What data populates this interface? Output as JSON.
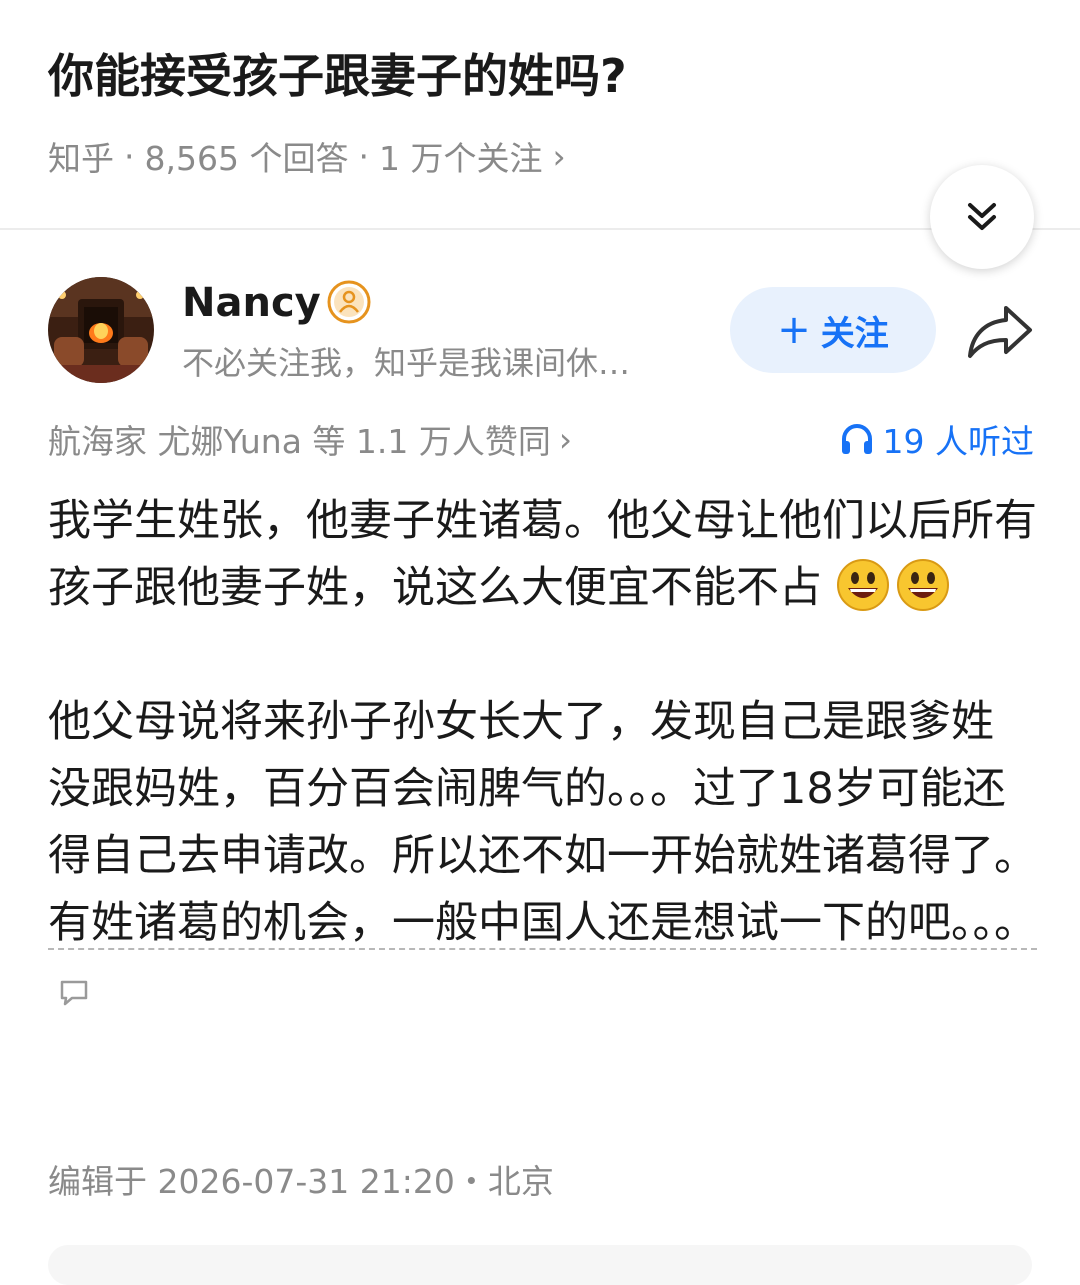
{
  "question": {
    "title": "你能接受孩子跟妻子的姓吗?",
    "source": "知乎",
    "answers": "8,565 个回答",
    "followers": "1 万个关注",
    "chevron": "›"
  },
  "author": {
    "name": "Nancy",
    "bio": "不必关注我，知乎是我课间休…",
    "follow_label": "关注",
    "follow_plus": "+"
  },
  "stats": {
    "upvote_text": "航海家 尤娜Yuna 等 1.1 万人赞同",
    "upvote_chevron": "›",
    "listen_text": "19 人听过"
  },
  "answer": {
    "para1": "我学生姓张，他妻子姓诸葛。他父母让他们以后所有孩子跟他妻子姓，说这么大便宜不能不占",
    "para2_plain": "他父母说将来孙子孙女长大了，发现自己是跟爹姓 没跟妈姓，百分百会闹脾气的。。。过了18岁可能还得自己去申请改。所以还不如一开始就姓诸葛得了。",
    "para2_underlined": "有姓诸葛的机会，一般中国人还是想试一下的吧。。。"
  },
  "edit": {
    "text": "编辑于 2026-07-31 21:20・北京"
  },
  "icons": {
    "collapse": "double-chevron-down-icon",
    "badge": "user-badge-icon",
    "share": "share-arrow-icon",
    "headphone": "headphone-icon",
    "emoji": "grinning-face-emoji",
    "comment": "comment-bubble-icon"
  },
  "colors": {
    "accent": "#1772f6",
    "follow_bg": "#e8f1fd",
    "meta_gray": "#8a8a8a",
    "badge_orange": "#f5a623"
  }
}
